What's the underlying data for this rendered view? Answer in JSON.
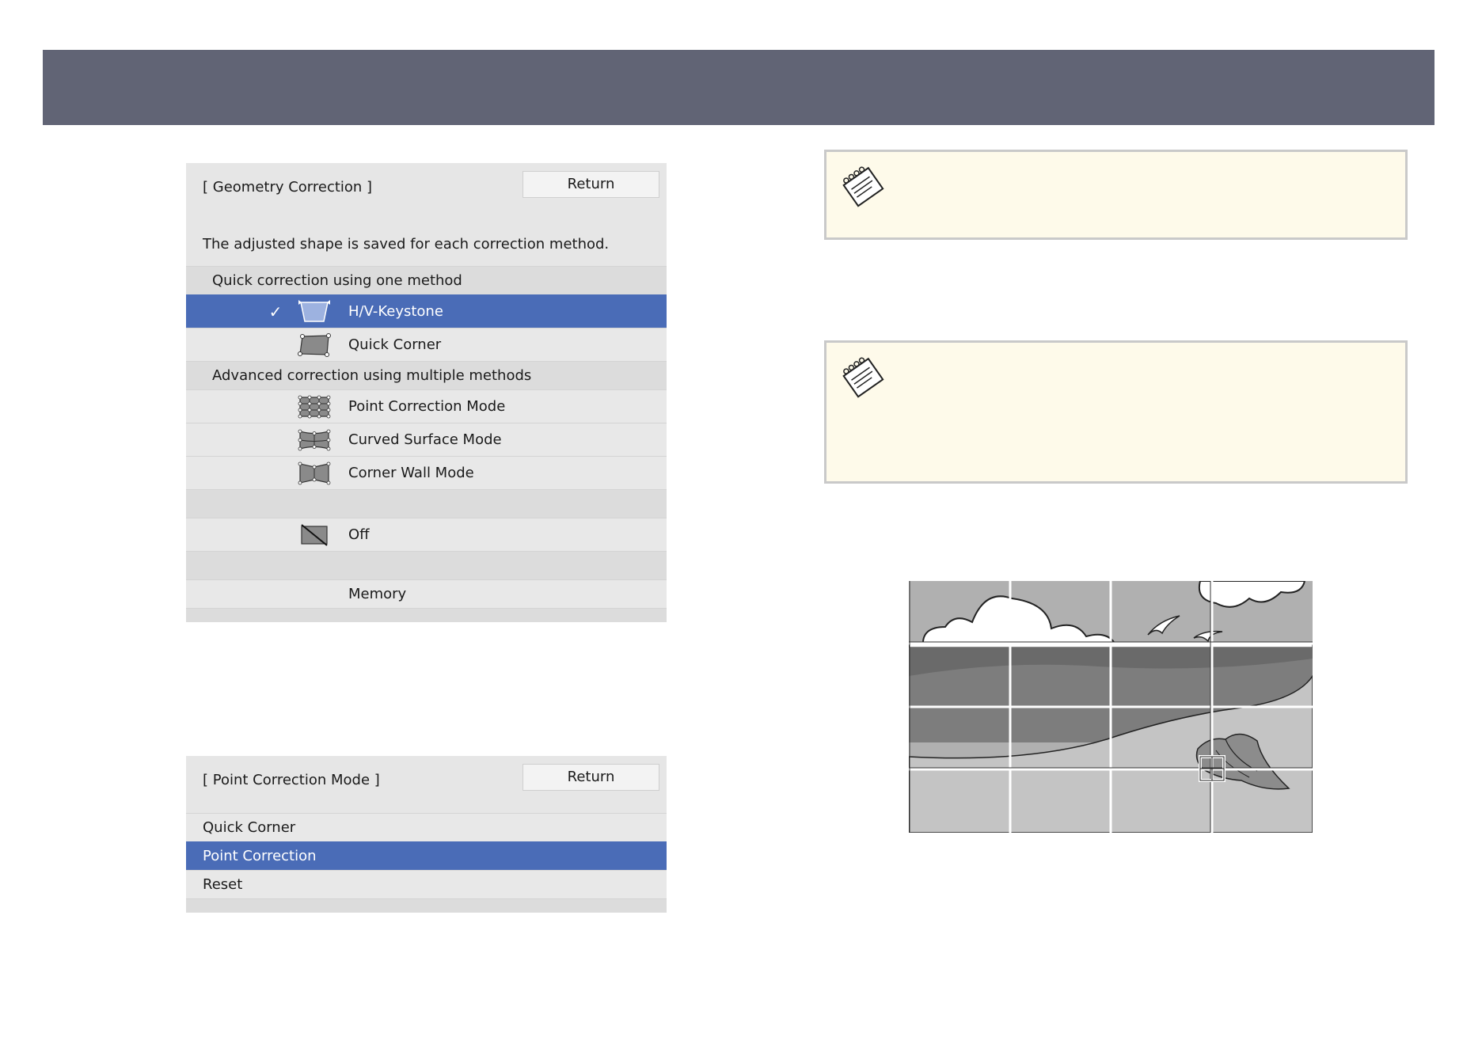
{
  "geometry_panel": {
    "title": "[ Geometry Correction ]",
    "return_label": "Return",
    "description": "The adjusted shape is saved for each correction method.",
    "sections": [
      {
        "label": "Quick correction using one method",
        "items": [
          {
            "label": "H/V-Keystone",
            "icon": "hv-keystone-icon",
            "selected": true,
            "checked": true
          },
          {
            "label": "Quick Corner",
            "icon": "quick-corner-icon",
            "selected": false,
            "checked": false
          }
        ]
      },
      {
        "label": "Advanced correction using multiple methods",
        "items": [
          {
            "label": "Point Correction Mode",
            "icon": "point-correction-icon"
          },
          {
            "label": "Curved Surface Mode",
            "icon": "curved-surface-icon"
          },
          {
            "label": "Corner Wall Mode",
            "icon": "corner-wall-icon"
          }
        ]
      }
    ],
    "off_label": "Off",
    "memory_label": "Memory",
    "check_glyph": "✓"
  },
  "point_panel": {
    "title": "[ Point Correction Mode ]",
    "return_label": "Return",
    "items": [
      {
        "label": "Quick Corner",
        "selected": false
      },
      {
        "label": "Point Correction",
        "selected": true
      },
      {
        "label": "Reset",
        "selected": false
      }
    ]
  },
  "notes": [
    {
      "icon": "note-icon"
    },
    {
      "icon": "note-icon"
    }
  ],
  "colors": {
    "header": "#616475",
    "selected": "#4a6cb7",
    "note_bg": "#fefaea"
  }
}
